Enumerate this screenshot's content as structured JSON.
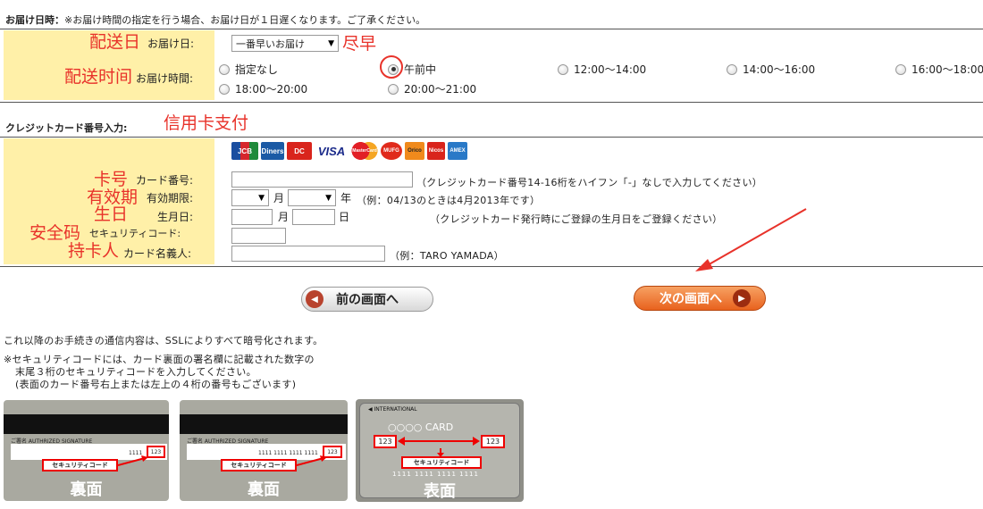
{
  "delivery": {
    "section_title": "お届け日時：",
    "section_note": "※お届け時間の指定を行う場合、お届け日が１日遅くなります。ご了承ください。",
    "date_annotation": "配送日",
    "date_label": "お届け日:",
    "date_select_value": "一番早いお届け",
    "date_select_annotation": "尽早",
    "time_annotation": "配送时间",
    "time_label": "お届け時間:",
    "time_options": [
      "指定なし",
      "午前中",
      "12:00～14:00",
      "14:00～16:00",
      "16:00～18:00",
      "18:00～20:00",
      "20:00～21:00"
    ],
    "time_selected": "午前中"
  },
  "card": {
    "section_title": "クレジットカード番号入力:",
    "section_annotation": "信用卡支付",
    "brand_logos": [
      "JCB",
      "Diners",
      "DC",
      "VISA",
      "MasterCard",
      "MUFG",
      "Orico",
      "Nicos",
      "AMEX"
    ],
    "number": {
      "annotation": "卡号",
      "label": "カード番号:",
      "value": "",
      "hint": "（クレジットカード番号14-16桁をハイフン「-」なしで入力してください）"
    },
    "expiry": {
      "annotation": "有效期",
      "label": "有効期限:",
      "month_unit": "月",
      "year_unit": "年",
      "hint": "（例：04/13のときは4月2013年です）"
    },
    "birthday": {
      "annotation": "生日",
      "label": "生月日:",
      "month_unit": "月",
      "day_unit": "日",
      "hint": "（クレジットカード発行時にご登録の生月日をご登録ください）"
    },
    "security": {
      "annotation": "安全码",
      "label": "セキュリティコード:"
    },
    "holder": {
      "annotation": "持卡人",
      "label": "カード名義人:",
      "hint": "（例：TARO YAMADA）"
    }
  },
  "buttons": {
    "prev_label": "前の画面へ",
    "next_label": "次の画面へ"
  },
  "info": {
    "ssl_note": "これ以降のお手続きの通信内容は、SSLによりすべて暗号化されます。",
    "security_note_lines": [
      "※セキュリティコードには、カード裏面の署名欄に記載された数字の",
      "末尾３桁のセキュリティコードを入力してください。",
      "(表面のカード番号右上または左上の４桁の番号もございます)"
    ]
  },
  "samples": [
    {
      "signature_label": "ご署名 AUTHRIZED SIGNATURE",
      "digits": "1111",
      "code": "123",
      "code_label": "セキュリティコード",
      "side_label": "裏面"
    },
    {
      "signature_label": "ご署名 AUTHRIZED SIGNATURE",
      "digits": "1111 1111 1111 1111",
      "code": "123",
      "code_label": "セキュリティコード",
      "side_label": "裏面"
    },
    {
      "top_label": "INTERNATIONAL",
      "card_label": "○○○○ CARD",
      "code_left": "123",
      "code_right": "123",
      "code_label": "セキュリティコード",
      "digits": "1111 1111 1111 1111",
      "side_label": "表面"
    }
  ],
  "colors": {
    "band": "#fff0a8",
    "annotation": "#e8322a",
    "next_button": "#e8621e"
  }
}
